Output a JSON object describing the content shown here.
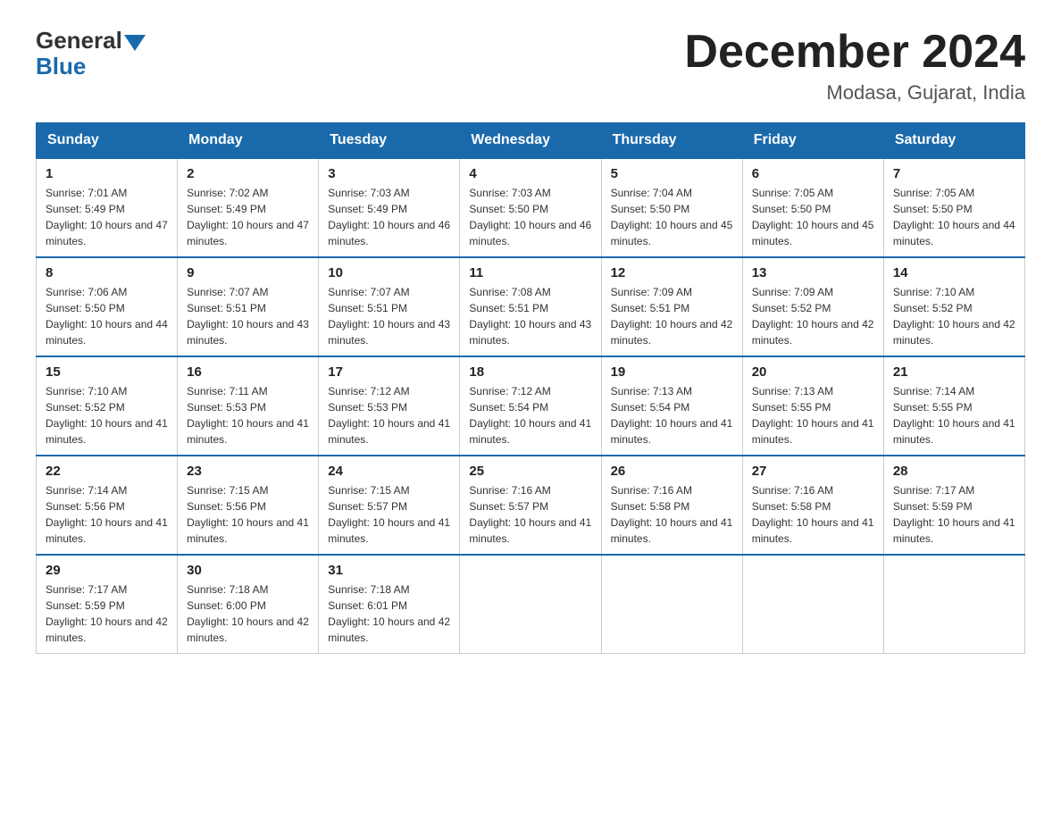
{
  "header": {
    "logo_general": "General",
    "logo_blue": "Blue",
    "month_title": "December 2024",
    "subtitle": "Modasa, Gujarat, India"
  },
  "weekdays": [
    "Sunday",
    "Monday",
    "Tuesday",
    "Wednesday",
    "Thursday",
    "Friday",
    "Saturday"
  ],
  "weeks": [
    [
      {
        "day": "1",
        "sunrise": "7:01 AM",
        "sunset": "5:49 PM",
        "daylight": "10 hours and 47 minutes."
      },
      {
        "day": "2",
        "sunrise": "7:02 AM",
        "sunset": "5:49 PM",
        "daylight": "10 hours and 47 minutes."
      },
      {
        "day": "3",
        "sunrise": "7:03 AM",
        "sunset": "5:49 PM",
        "daylight": "10 hours and 46 minutes."
      },
      {
        "day": "4",
        "sunrise": "7:03 AM",
        "sunset": "5:50 PM",
        "daylight": "10 hours and 46 minutes."
      },
      {
        "day": "5",
        "sunrise": "7:04 AM",
        "sunset": "5:50 PM",
        "daylight": "10 hours and 45 minutes."
      },
      {
        "day": "6",
        "sunrise": "7:05 AM",
        "sunset": "5:50 PM",
        "daylight": "10 hours and 45 minutes."
      },
      {
        "day": "7",
        "sunrise": "7:05 AM",
        "sunset": "5:50 PM",
        "daylight": "10 hours and 44 minutes."
      }
    ],
    [
      {
        "day": "8",
        "sunrise": "7:06 AM",
        "sunset": "5:50 PM",
        "daylight": "10 hours and 44 minutes."
      },
      {
        "day": "9",
        "sunrise": "7:07 AM",
        "sunset": "5:51 PM",
        "daylight": "10 hours and 43 minutes."
      },
      {
        "day": "10",
        "sunrise": "7:07 AM",
        "sunset": "5:51 PM",
        "daylight": "10 hours and 43 minutes."
      },
      {
        "day": "11",
        "sunrise": "7:08 AM",
        "sunset": "5:51 PM",
        "daylight": "10 hours and 43 minutes."
      },
      {
        "day": "12",
        "sunrise": "7:09 AM",
        "sunset": "5:51 PM",
        "daylight": "10 hours and 42 minutes."
      },
      {
        "day": "13",
        "sunrise": "7:09 AM",
        "sunset": "5:52 PM",
        "daylight": "10 hours and 42 minutes."
      },
      {
        "day": "14",
        "sunrise": "7:10 AM",
        "sunset": "5:52 PM",
        "daylight": "10 hours and 42 minutes."
      }
    ],
    [
      {
        "day": "15",
        "sunrise": "7:10 AM",
        "sunset": "5:52 PM",
        "daylight": "10 hours and 41 minutes."
      },
      {
        "day": "16",
        "sunrise": "7:11 AM",
        "sunset": "5:53 PM",
        "daylight": "10 hours and 41 minutes."
      },
      {
        "day": "17",
        "sunrise": "7:12 AM",
        "sunset": "5:53 PM",
        "daylight": "10 hours and 41 minutes."
      },
      {
        "day": "18",
        "sunrise": "7:12 AM",
        "sunset": "5:54 PM",
        "daylight": "10 hours and 41 minutes."
      },
      {
        "day": "19",
        "sunrise": "7:13 AM",
        "sunset": "5:54 PM",
        "daylight": "10 hours and 41 minutes."
      },
      {
        "day": "20",
        "sunrise": "7:13 AM",
        "sunset": "5:55 PM",
        "daylight": "10 hours and 41 minutes."
      },
      {
        "day": "21",
        "sunrise": "7:14 AM",
        "sunset": "5:55 PM",
        "daylight": "10 hours and 41 minutes."
      }
    ],
    [
      {
        "day": "22",
        "sunrise": "7:14 AM",
        "sunset": "5:56 PM",
        "daylight": "10 hours and 41 minutes."
      },
      {
        "day": "23",
        "sunrise": "7:15 AM",
        "sunset": "5:56 PM",
        "daylight": "10 hours and 41 minutes."
      },
      {
        "day": "24",
        "sunrise": "7:15 AM",
        "sunset": "5:57 PM",
        "daylight": "10 hours and 41 minutes."
      },
      {
        "day": "25",
        "sunrise": "7:16 AM",
        "sunset": "5:57 PM",
        "daylight": "10 hours and 41 minutes."
      },
      {
        "day": "26",
        "sunrise": "7:16 AM",
        "sunset": "5:58 PM",
        "daylight": "10 hours and 41 minutes."
      },
      {
        "day": "27",
        "sunrise": "7:16 AM",
        "sunset": "5:58 PM",
        "daylight": "10 hours and 41 minutes."
      },
      {
        "day": "28",
        "sunrise": "7:17 AM",
        "sunset": "5:59 PM",
        "daylight": "10 hours and 41 minutes."
      }
    ],
    [
      {
        "day": "29",
        "sunrise": "7:17 AM",
        "sunset": "5:59 PM",
        "daylight": "10 hours and 42 minutes."
      },
      {
        "day": "30",
        "sunrise": "7:18 AM",
        "sunset": "6:00 PM",
        "daylight": "10 hours and 42 minutes."
      },
      {
        "day": "31",
        "sunrise": "7:18 AM",
        "sunset": "6:01 PM",
        "daylight": "10 hours and 42 minutes."
      },
      null,
      null,
      null,
      null
    ]
  ]
}
